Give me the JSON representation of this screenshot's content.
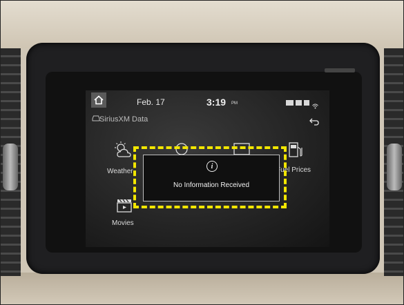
{
  "screen": {
    "date": "Feb. 17",
    "time": "3:19",
    "time_suffix": "PM",
    "page_title": "SiriusXM Data",
    "menu": [
      {
        "label": "Weather",
        "icon": "weather-icon"
      },
      {
        "label": "Fuel Prices",
        "icon": "fuel-pump-icon"
      },
      {
        "label": "Movies",
        "icon": "movie-clapper-icon"
      }
    ],
    "popup": {
      "message": "No Information Received",
      "icon": "info-icon"
    },
    "status_icons": [
      "battery-icon",
      "bluetooth-phone-icon",
      "signal-icon",
      "wifi-icon"
    ]
  },
  "annotation": {
    "color": "#f2e600",
    "style": "dashed"
  },
  "colors": {
    "screen_bg": "#232323",
    "text": "#e8e8e8",
    "bezel": "#1f1f21"
  }
}
